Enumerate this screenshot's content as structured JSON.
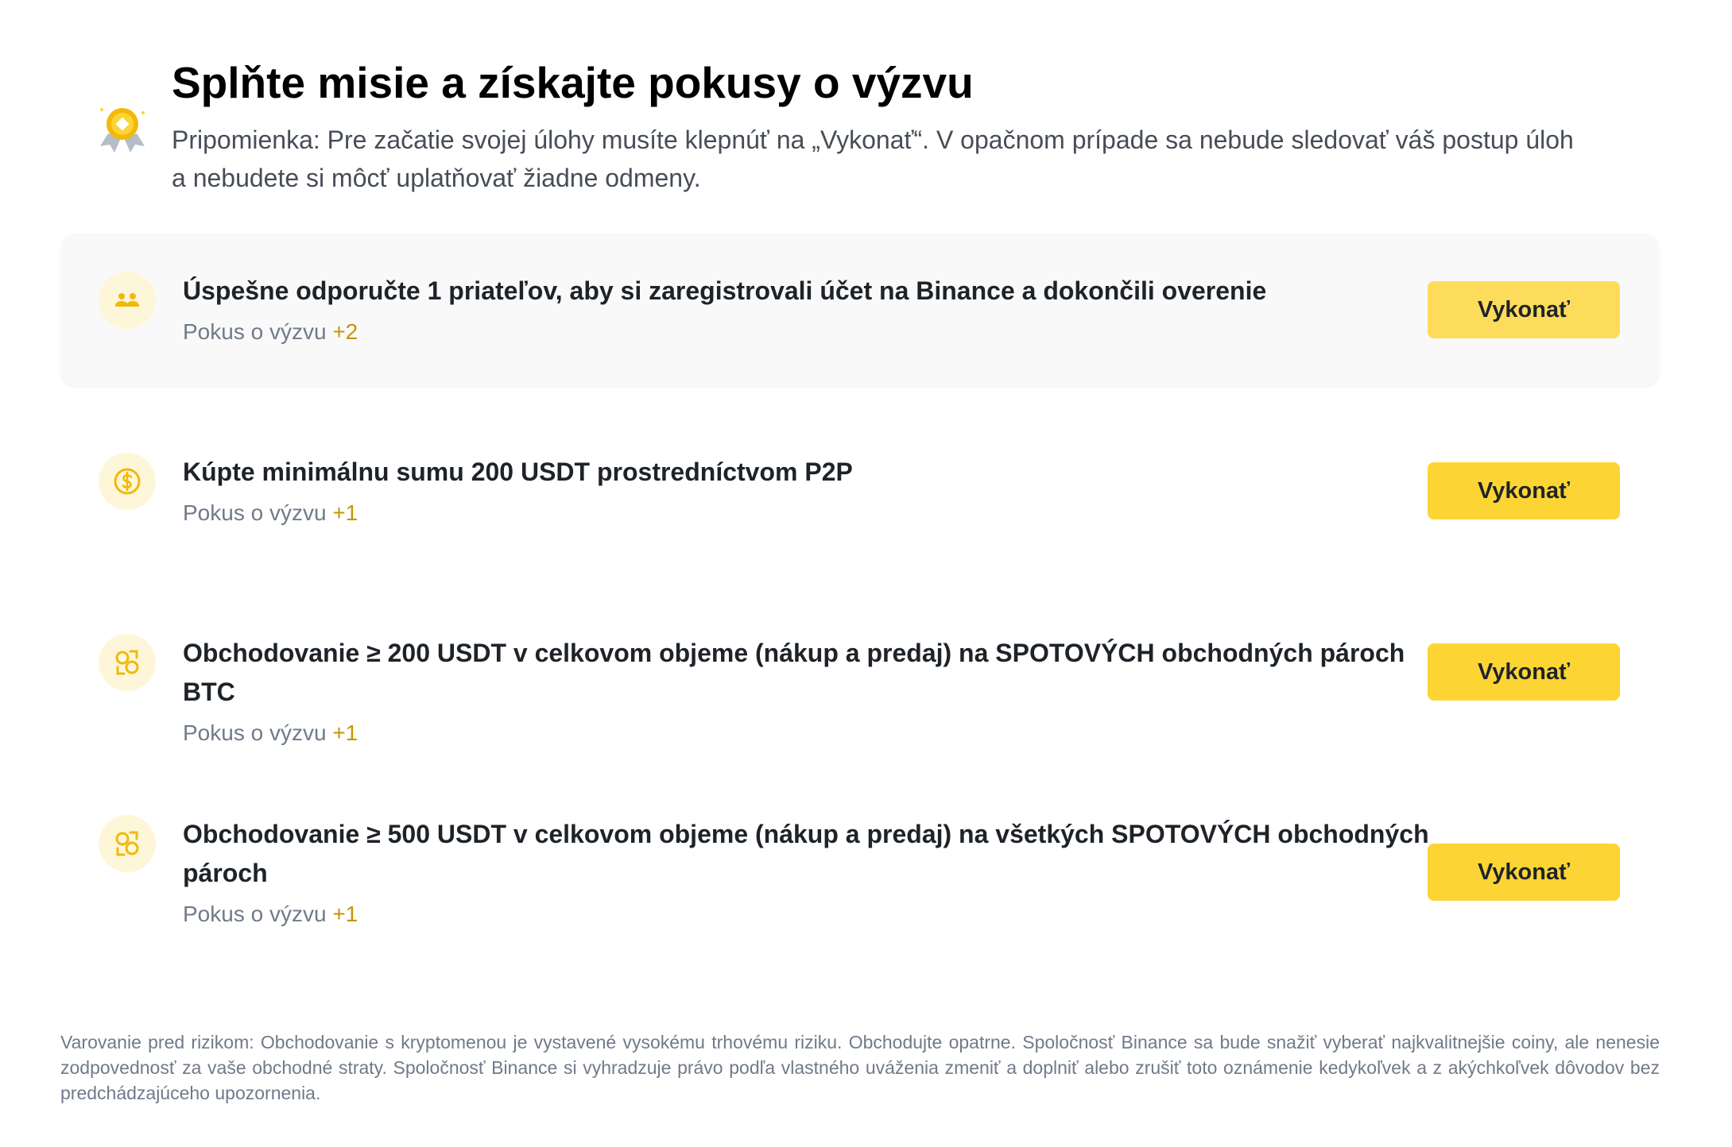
{
  "header": {
    "medal_icon": "medal-award-icon",
    "title": "Splňte misie a získajte pokusy o výzvu",
    "reminder_line1": "Pripomienka: Pre začatie svojej úlohy musíte klepnúť na „Vykonať“. V opačnom prípade sa nebude sledovať váš postup úloh",
    "reminder_line2": "a nebudete si môcť uplatňovať žiadne odmeny."
  },
  "missions": [
    {
      "icon": "referral-users-icon",
      "title": "Úspešne odporučte 1 priateľov, aby si zaregistrovali účet na Binance a dokončili overenie",
      "reward_label": "Pokus o výzvu",
      "reward_value": "+2",
      "button_label": "Vykonať"
    },
    {
      "icon": "dollar-coin-icon",
      "title": "Kúpte minimálnu sumu 200 USDT prostredníctvom P2P",
      "reward_label": "Pokus o výzvu",
      "reward_value": "+1",
      "button_label": "Vykonať"
    },
    {
      "icon": "trade-exchange-icon",
      "title": "Obchodovanie ≥ 200 USDT v celkovom objeme (nákup a predaj) na SPOTOVÝCH obchodných pároch BTC",
      "reward_label": "Pokus o výzvu",
      "reward_value": "+1",
      "button_label": "Vykonať"
    },
    {
      "icon": "trade-exchange-icon",
      "title_line1": "Obchodovanie ≥ 500 USDT v celkovom objeme (nákup a predaj) na všetkých SPOTOVÝCH obchodných",
      "title_line2": "pároch",
      "reward_label": "Pokus o výzvu",
      "reward_value": "+1",
      "button_label": "Vykonať"
    }
  ],
  "risk_warning": "Varovanie pred rizikom: Obchodovanie s kryptomenou je vystavené vysokému trhovému riziku. Obchodujte opatrne. Spoločnosť Binance sa bude snažiť vyberať najkvalitnejšie coiny, ale nenesie zodpovednosť za vaše obchodné straty. Spoločnosť Binance si vyhradzuje právo podľa vlastného uváženia zmeniť a doplniť alebo zrušiť toto oznámenie kedykoľvek a z akýchkoľvek dôvodov bez predchádzajúceho upozornenia.",
  "colors": {
    "accent": "#fcd535",
    "reward": "#c99400",
    "icon_bg": "#fef6d8",
    "card_bg": "#f9f9f9"
  }
}
